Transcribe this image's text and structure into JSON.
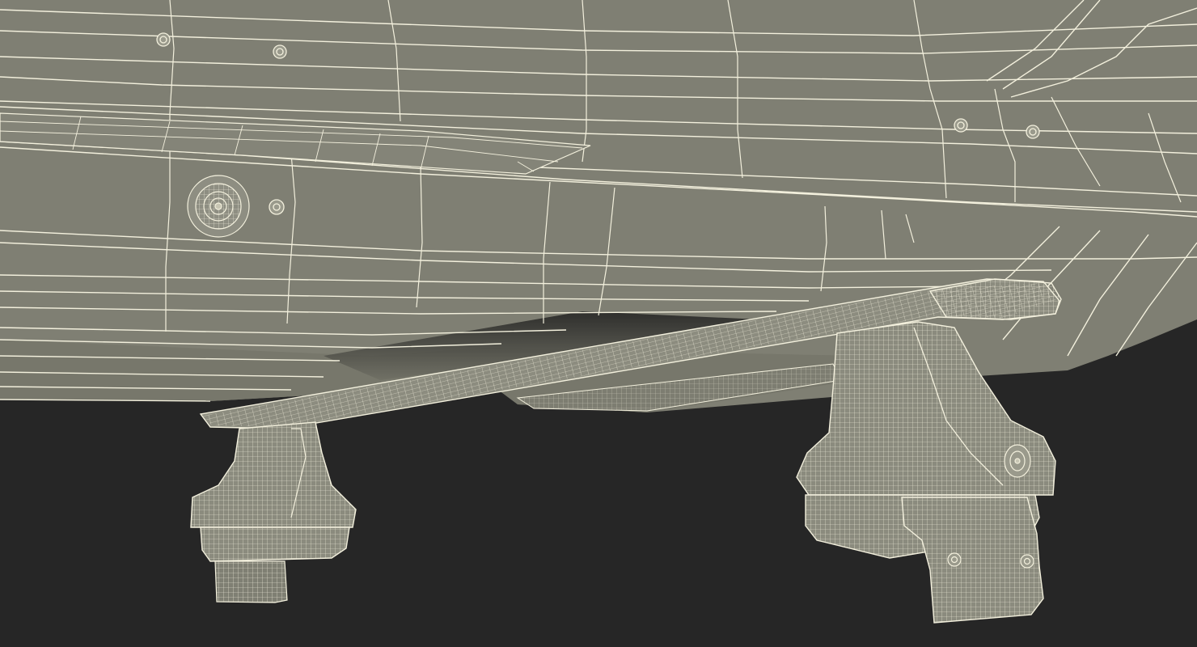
{
  "scene": {
    "subject": "",
    "render_style": "wireframe",
    "colors": {
      "background": "#262626",
      "surface": "#7f7f73",
      "surface_dark": "#6f6f64",
      "surface_light": "#8b8b7e",
      "wire": "#f3f0dd",
      "shadow": "#141414"
    },
    "parts": [
      {
        "id": "roof-box-hull",
        "icon": "roof-box-icon"
      },
      {
        "id": "crossbar",
        "icon": "crossbar-icon"
      },
      {
        "id": "foot-left",
        "icon": "rack-foot-icon"
      },
      {
        "id": "foot-right",
        "icon": "rack-foot-icon"
      },
      {
        "id": "clamp-right",
        "icon": "clamp-icon"
      },
      {
        "id": "lock-cylinder",
        "icon": "lock-icon"
      },
      {
        "id": "bolts",
        "icon": "bolt-icon"
      }
    ]
  }
}
